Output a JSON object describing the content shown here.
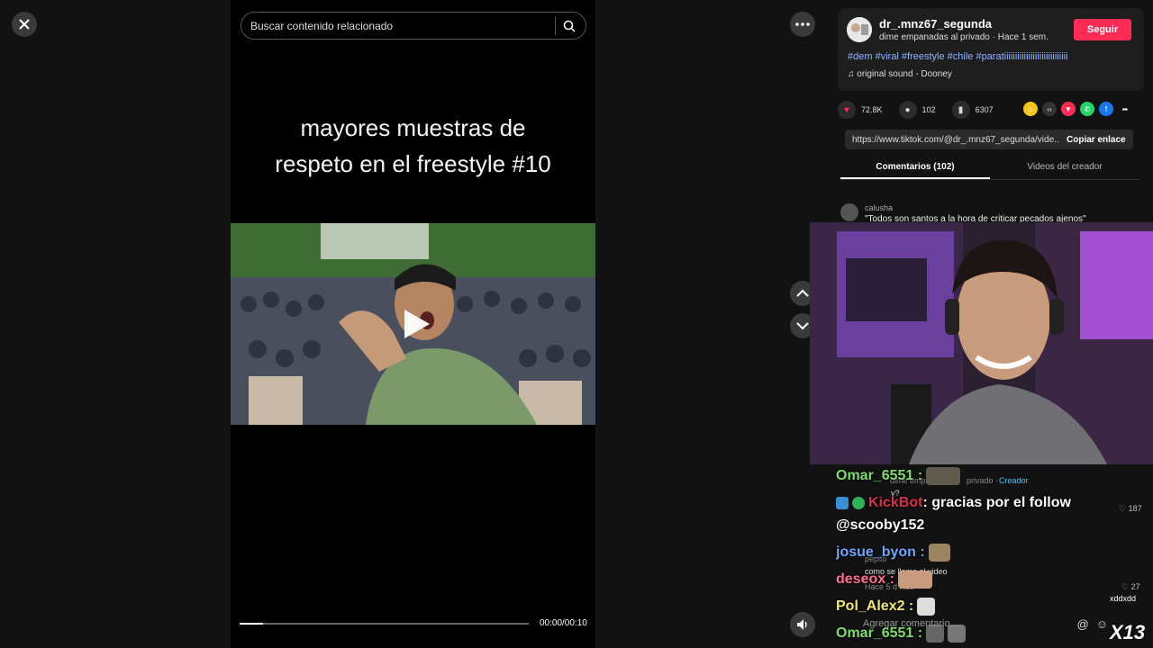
{
  "search": {
    "placeholder": "Buscar contenido relacionado"
  },
  "video": {
    "title_line1": "mayores muestras de",
    "title_line2": "respeto en el freestyle #10",
    "time": "00:00/00:10",
    "progress": 0.08
  },
  "creator": {
    "username": "dr_.mnz67_segunda",
    "subline": "dime empanadas al privado · Hace 1 sem.",
    "follow_label": "Seguir",
    "hashtags": "#dem #viral #freestyle #chile #paratiiiiiiiiiiiiiiiiiiiiiiiiiiiii",
    "sound": "original sound - Dooney"
  },
  "stats": {
    "likes": "72.8K",
    "comments": "102",
    "saves": "6307"
  },
  "link": {
    "url": "https://www.tiktok.com/@dr_.mnz67_segunda/vide...",
    "copy_label": "Copiar enlace"
  },
  "tabs": [
    {
      "label": "Comentarios (102)"
    },
    {
      "label": "Videos del creador"
    }
  ],
  "comments": [
    {
      "user": "calusha",
      "text": "\"Todos son santos a la hora de criticar pecados ajenos\""
    }
  ],
  "chat": [
    {
      "user": "Omar_6551 :",
      "message": ""
    },
    {
      "user": "KickBot",
      "message": ": gracias por el follow"
    },
    {
      "user": "@scooby152",
      "message": ""
    },
    {
      "user": "josue_byon :",
      "message": ""
    },
    {
      "user": "deseox :",
      "message": ""
    },
    {
      "user": "Pol_Alex2 :",
      "message": ""
    },
    {
      "user": "Omar_6551 :",
      "message": ""
    }
  ],
  "underlay": {
    "creator_tag": "Creador",
    "dime_emp": "dime empa",
    "privado": "privado ·",
    "y": "y?",
    "pepito": "pepito",
    "como_se": "como se llama el video",
    "hace": "Hace 5 d   Res",
    "likes_187": "187",
    "likes_27": "27"
  },
  "comment_bar": {
    "placeholder": "Agregar comentario..."
  },
  "overlay_badges": {
    "xddxdd": "xddxdd",
    "x13": "X13"
  },
  "colors": {
    "follow": "#fe2c55",
    "hashtag": "#8fb4ff",
    "like": "#fe2c55"
  },
  "icons": [
    "close-icon",
    "search-icon",
    "more-icon",
    "chevron-up-icon",
    "chevron-down-icon",
    "volume-icon",
    "play-icon",
    "heart-icon",
    "comment-icon",
    "bookmark-icon",
    "music-note-icon"
  ]
}
